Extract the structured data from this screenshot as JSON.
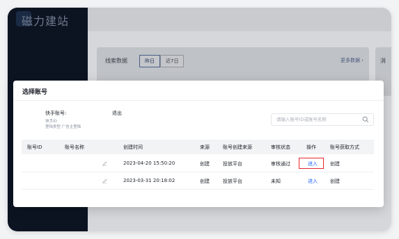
{
  "app": {
    "brand": "磁力建站"
  },
  "background_card": {
    "title": "线索数据",
    "tabs": [
      {
        "label": "昨日",
        "active": true
      },
      {
        "label": "近7日",
        "active": false
      }
    ],
    "more_link": "更多数据 ›",
    "side_card_text": "消"
  },
  "modal": {
    "title": "选择账号",
    "account": {
      "label": "快手账号:",
      "id_label": "快手ID",
      "type_line": "登陆类型 广告主登陆",
      "logout": "退出"
    },
    "search": {
      "placeholder": "请输入账号ID或账号名称",
      "value": ""
    },
    "table": {
      "headers": [
        "账号ID",
        "账号名称",
        "创建时间",
        "来源",
        "账号创建来源",
        "审核状态",
        "操作",
        "账号获取方式"
      ],
      "rows": [
        {
          "id": "",
          "name": "",
          "created": "2023-04-20 15:50:20",
          "source": "创建",
          "create_source": "投放平台",
          "status": "审核通过",
          "action": "进入",
          "acquire": "创建",
          "highlighted": true
        },
        {
          "id": "",
          "name": "",
          "created": "2023-03-31 20:18:02",
          "source": "创建",
          "create_source": "投放平台",
          "status": "未知",
          "action": "进入",
          "acquire": "创建",
          "highlighted": false
        }
      ]
    }
  },
  "colors": {
    "link": "#165dff",
    "highlight": "#e8262d",
    "sidebar": "#0c1422"
  },
  "icons": {
    "search": "search-icon",
    "edit": "pencil-icon"
  }
}
